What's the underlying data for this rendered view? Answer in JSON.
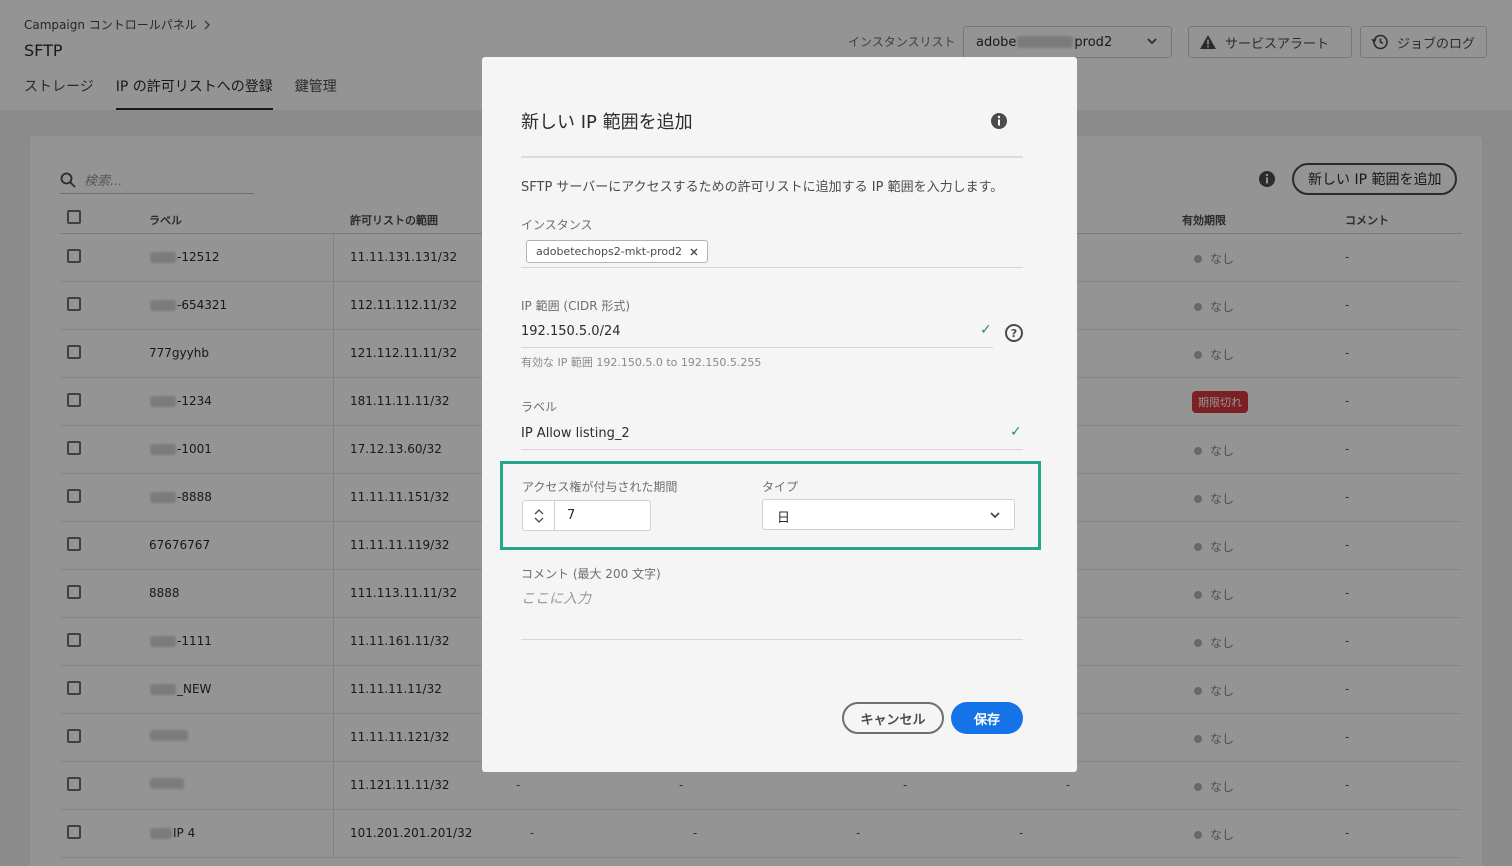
{
  "header": {
    "breadcrumb": "Campaign コントロールパネル",
    "title": "SFTP",
    "tabs": [
      {
        "label": "ストレージ"
      },
      {
        "label": "IP の許可リストへの登録"
      },
      {
        "label": "鍵管理"
      }
    ],
    "instance_label": "インスタンスリスト",
    "instance_prefix": "adobe",
    "instance_suffix": "prod2",
    "service_alert": "サービスアラート",
    "job_log": "ジョブのログ"
  },
  "table": {
    "search_placeholder": "検索...",
    "add_button": "新しい IP 範囲を追加",
    "columns": {
      "label": "ラベル",
      "range": "許可リストの範囲",
      "expiry": "有効期限",
      "comment": "コメント"
    },
    "rows": [
      {
        "label": "-12512",
        "range": "11.11.131.131/32",
        "expiry": "なし",
        "comment": "-"
      },
      {
        "label": "-654321",
        "range": "112.11.112.11/32",
        "expiry": "なし",
        "comment": "-"
      },
      {
        "label": "777gyyhb",
        "range": "121.112.11.11/32",
        "expiry": "なし",
        "comment": "-"
      },
      {
        "label": "-1234",
        "range": "181.11.11.11/32",
        "expiry": "期限切れ",
        "comment": "-"
      },
      {
        "label": "-1001",
        "range": "17.12.13.60/32",
        "expiry": "なし",
        "comment": "-"
      },
      {
        "label": "-8888",
        "range": "11.11.11.151/32",
        "expiry": "なし",
        "comment": "-"
      },
      {
        "label": "67676767",
        "range": "11.11.11.119/32",
        "expiry": "なし",
        "comment": "-"
      },
      {
        "label": "8888",
        "range": "111.113.11.11/32",
        "expiry": "なし",
        "comment": "-"
      },
      {
        "label": "-1111",
        "range": "11.11.161.11/32",
        "expiry": "なし",
        "comment": "-"
      },
      {
        "label": "_NEW",
        "range": "11.11.11.11/32",
        "expiry": "なし",
        "comment": "-"
      },
      {
        "label": "",
        "range": "11.11.11.121/32",
        "expiry": "なし",
        "comment": "-"
      },
      {
        "label": "",
        "range": "11.121.11.11/32",
        "expiry": "なし",
        "comment": "-"
      },
      {
        "label": "IP 4",
        "range": "101.201.201.201/32",
        "expiry": "なし",
        "comment": "-"
      }
    ]
  },
  "dialog": {
    "title": "新しい IP 範囲を追加",
    "description": "SFTP サーバーにアクセスするための許可リストに追加する IP 範囲を入力します。",
    "instance_label": "インスタンス",
    "instance_tag": "adobetechops2-mkt-prod2",
    "ip_label": "IP 範囲 (CIDR 形式)",
    "ip_value": "192.150.5.0/24",
    "ip_help": "有効な IP 範囲 192.150.5.0 to 192.150.5.255",
    "label_label": "ラベル",
    "label_value": "IP Allow listing_2",
    "duration_label": "アクセス権が付与された期間",
    "duration_value": "7",
    "type_label": "タイプ",
    "type_value": "日",
    "comment_label": "コメント (最大 200 文字)",
    "comment_placeholder": "ここに入力",
    "cancel": "キャンセル",
    "save": "保存"
  },
  "colors": {
    "accent": "#1473e6",
    "highlight": "#26a68a",
    "expired": "#d7373f",
    "valid": "#268e6c"
  }
}
